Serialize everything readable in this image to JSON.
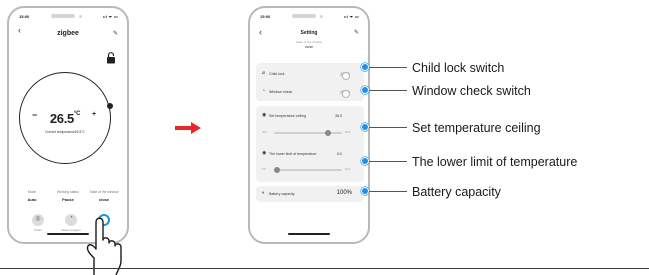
{
  "phone_main": {
    "status_time": "15:00",
    "status_icons": "ııl ᯤ ▭",
    "title": "zigbee",
    "back_icon": "chevron-left-icon",
    "edit_icon": "pencil-icon",
    "lock_icon": "lock-icon",
    "dial": {
      "minus": "−",
      "temperature": "26.5",
      "unit": "°C",
      "plus": "+",
      "caption": "Current temperature26.5°C"
    },
    "info": [
      {
        "label": "Mode",
        "value": "Auto"
      },
      {
        "label": "Working status",
        "value": "Pause"
      },
      {
        "label": "State of the window",
        "value": "close"
      }
    ],
    "bottom_bar": [
      {
        "icon": "mode-icon",
        "glyph": "◎",
        "label": "Mode"
      },
      {
        "icon": "week-program-icon",
        "glyph": "◔",
        "label": "Week program"
      },
      {
        "icon": "setting-icon",
        "glyph": "",
        "label": ""
      }
    ]
  },
  "arrow_color": "#e8262b",
  "phone_setting": {
    "status_time": "15:00",
    "status_icons": "ııl ᯤ ▭",
    "title": "Setting",
    "subtitle": "State of the window",
    "subtitle_value": "close",
    "child_lock": {
      "icon": "child-lock-icon",
      "label": "Child lock",
      "on": false
    },
    "window_check": {
      "icon": "window-check-icon",
      "label": "Window check",
      "on": false
    },
    "ceiling": {
      "icon": "thermometer-icon",
      "label": "Set temperature ceiling",
      "value": "35.0",
      "min": "20.0",
      "max": "35.0",
      "level": 0.8
    },
    "lower": {
      "icon": "thermometer-icon",
      "label": "The lower limit of temperature",
      "value": "5.0",
      "min": "5.0",
      "max": "15.0",
      "level": 0.05
    },
    "battery": {
      "icon": "battery-icon",
      "label": "Battery capacity",
      "value": "100%"
    }
  },
  "callouts": [
    "Child lock switch",
    "Window check switch",
    "Set temperature ceiling",
    "The lower limit of temperature",
    "Battery capacity"
  ],
  "accent_color": "#1e90e6"
}
